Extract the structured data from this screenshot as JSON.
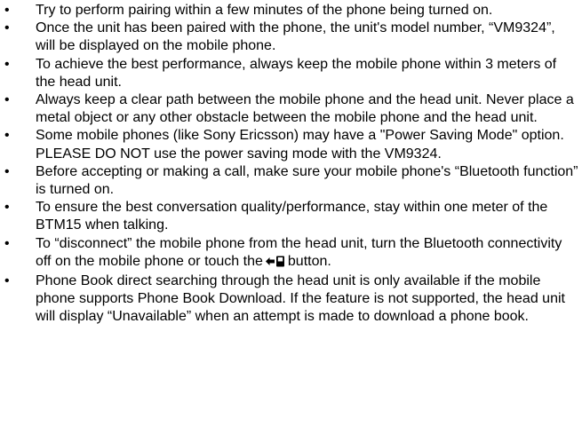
{
  "bullet_char": "•",
  "notes": [
    {
      "text": "Try to perform pairing within a few minutes of the phone being turned on."
    },
    {
      "text": "Once the unit has been paired with the phone, the unit's model number, “VM9324”, will be displayed on the mobile phone."
    },
    {
      "text": "To achieve the best performance, always keep the mobile phone within 3 meters of the head unit."
    },
    {
      "text": "Always keep a clear path between the mobile phone and the head unit. Never place a metal object or any other obstacle between the mobile phone and the head unit."
    },
    {
      "text": "Some mobile phones (like Sony Ericsson) may have a \"Power Saving Mode\" option. PLEASE DO NOT use the power saving mode with the VM9324."
    },
    {
      "text": "Before accepting or making a call, make sure your mobile phone's “Bluetooth function” is turned on."
    },
    {
      "text": "To ensure the best conversation quality/performance, stay within one meter of the BTM15 when talking."
    },
    {
      "text_before": "To “disconnect” the mobile phone from the head unit, turn the Bluetooth connectivity off on the mobile phone or touch the",
      "icon": "disconnect-phone-icon",
      "text_after": "button."
    },
    {
      "text": "Phone Book direct searching through the head unit is only available if the mobile phone supports Phone Book Download. If the feature is not supported, the head unit will display “Unavailable” when an attempt is made to download a phone book."
    }
  ]
}
